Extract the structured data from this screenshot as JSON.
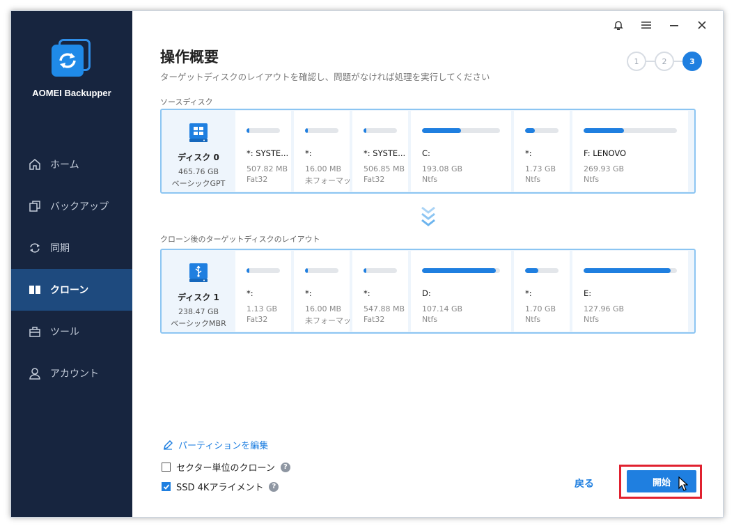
{
  "app": {
    "name": "AOMEI Backupper"
  },
  "sidebar": {
    "items": [
      {
        "label": "ホーム",
        "icon": "home-icon"
      },
      {
        "label": "バックアップ",
        "icon": "copy-icon"
      },
      {
        "label": "同期",
        "icon": "sync-icon"
      },
      {
        "label": "クローン",
        "icon": "clone-icon",
        "active": true
      },
      {
        "label": "ツール",
        "icon": "toolbox-icon"
      },
      {
        "label": "アカウント",
        "icon": "user-icon"
      }
    ]
  },
  "header": {
    "title": "操作概要",
    "subtitle": "ターゲットディスクのレイアウトを確認し、問題がなければ処理を実行してください",
    "steps": [
      "1",
      "2",
      "3"
    ],
    "active_step": 3
  },
  "source": {
    "label": "ソースディスク",
    "disk": {
      "name": "ディスク 0",
      "size": "465.76 GB",
      "type": "ベーシックGPT"
    },
    "partitions": [
      {
        "name": "*: SYSTE...",
        "size": "507.82 MB",
        "fs": "Fat32",
        "used": 0.05
      },
      {
        "name": "*:",
        "size": "16.00 MB",
        "fs": "未フォーマット",
        "used": 0.05
      },
      {
        "name": "*: SYSTE...",
        "size": "506.85 MB",
        "fs": "Fat32",
        "used": 0.05
      },
      {
        "name": "C:",
        "size": "193.08 GB",
        "fs": "Ntfs",
        "used": 0.5
      },
      {
        "name": "*:",
        "size": "1.73 GB",
        "fs": "Ntfs",
        "used": 0.3
      },
      {
        "name": "F: LENOVO",
        "size": "269.93 GB",
        "fs": "Ntfs",
        "used": 0.43
      }
    ]
  },
  "target": {
    "label": "クローン後のターゲットディスクのレイアウト",
    "disk": {
      "name": "ディスク 1",
      "size": "238.47 GB",
      "type": "ベーシックMBR"
    },
    "partitions": [
      {
        "name": "*:",
        "size": "1.13 GB",
        "fs": "Fat32",
        "used": 0.05
      },
      {
        "name": "*:",
        "size": "16.00 MB",
        "fs": "未フォーマット",
        "used": 0.05
      },
      {
        "name": "*:",
        "size": "547.88 MB",
        "fs": "Fat32",
        "used": 0.05
      },
      {
        "name": "D:",
        "size": "107.14 GB",
        "fs": "Ntfs",
        "used": 0.95
      },
      {
        "name": "*:",
        "size": "1.70 GB",
        "fs": "Ntfs",
        "used": 0.4
      },
      {
        "name": "E:",
        "size": "127.96 GB",
        "fs": "Ntfs",
        "used": 0.93
      }
    ]
  },
  "footer": {
    "edit_partitions": "パーティションを編集",
    "sector_clone": "セクター単位のクローン",
    "sector_clone_checked": false,
    "ssd_align": "SSD 4Kアライメント",
    "ssd_align_checked": true,
    "back_label": "戻る",
    "start_label": "開始"
  },
  "colors": {
    "accent": "#1f7fe0",
    "sidebar": "#17253f",
    "sidebar_active": "#1e4a7e",
    "highlight": "#e0212f"
  }
}
